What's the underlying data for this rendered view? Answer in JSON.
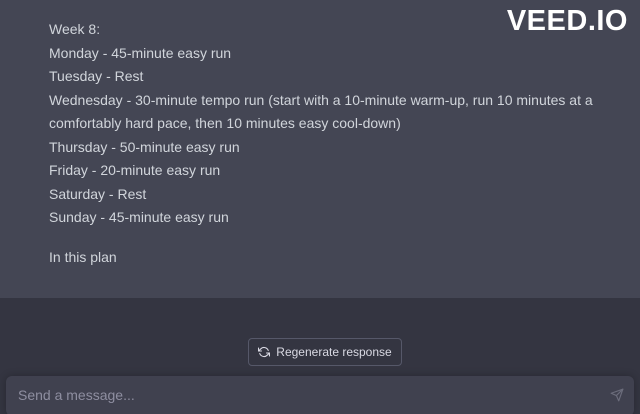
{
  "brand": {
    "watermark": "VEED.IO"
  },
  "message": {
    "lines": [
      "Week 8:",
      "Monday - 45-minute easy run",
      "Tuesday - Rest",
      "Wednesday - 30-minute tempo run (start with a 10-minute warm-up, run 10 minutes at a comfortably hard pace, then 10 minutes easy cool-down)",
      "Thursday - 50-minute easy run",
      "Friday - 20-minute easy run",
      "Saturday - Rest",
      "Sunday - 45-minute easy run"
    ],
    "tail": "In this plan"
  },
  "actions": {
    "regenerate_label": "Regenerate response"
  },
  "composer": {
    "placeholder": "Send a message..."
  },
  "icons": {
    "regenerate": "refresh-icon",
    "send": "send-icon"
  },
  "colors": {
    "background": "#343541",
    "message_background": "#444654",
    "text": "#d1d5db",
    "input_background": "#40414f"
  }
}
